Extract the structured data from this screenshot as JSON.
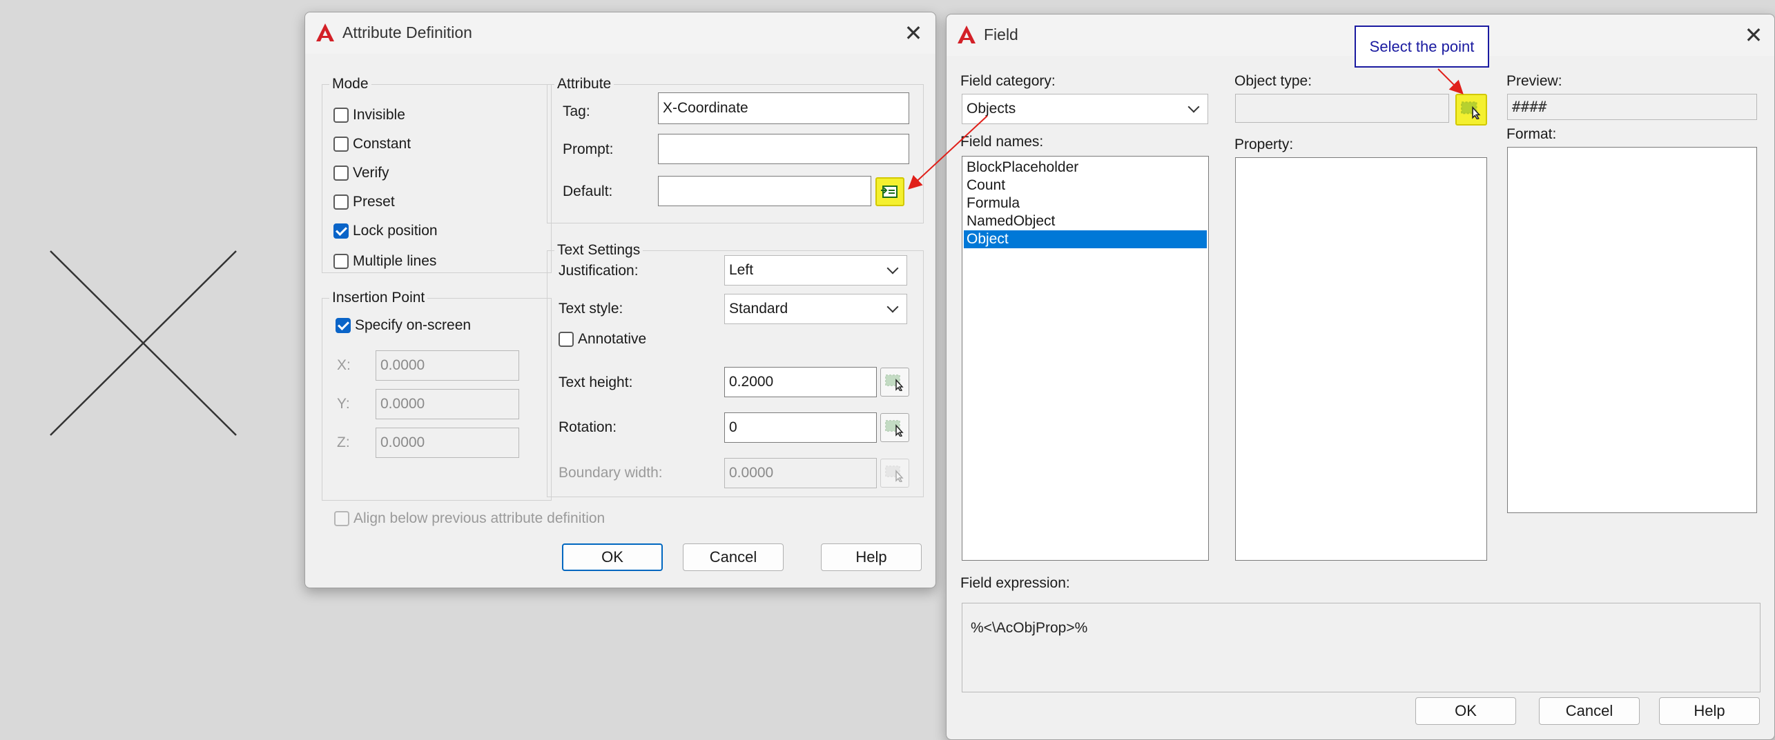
{
  "attr_dialog": {
    "title": "Attribute Definition",
    "mode": {
      "legend": "Mode",
      "items": [
        {
          "label": "Invisible",
          "checked": false
        },
        {
          "label": "Constant",
          "checked": false
        },
        {
          "label": "Verify",
          "checked": false
        },
        {
          "label": "Preset",
          "checked": false
        },
        {
          "label": "Lock position",
          "checked": true
        },
        {
          "label": "Multiple lines",
          "checked": false
        }
      ]
    },
    "insertion": {
      "legend": "Insertion Point",
      "specify_label": "Specify on-screen",
      "specify_checked": true,
      "x_label": "X:",
      "x_value": "0.0000",
      "y_label": "Y:",
      "y_value": "0.0000",
      "z_label": "Z:",
      "z_value": "0.0000"
    },
    "attribute": {
      "legend": "Attribute",
      "tag_label": "Tag:",
      "tag_value": "X-Coordinate",
      "prompt_label": "Prompt:",
      "prompt_value": "",
      "default_label": "Default:",
      "default_value": ""
    },
    "text_settings": {
      "legend": "Text Settings",
      "justification_label": "Justification:",
      "justification_value": "Left",
      "style_label": "Text style:",
      "style_value": "Standard",
      "annotative_label": "Annotative",
      "annotative_checked": false,
      "height_label": "Text height:",
      "height_value": "0.2000",
      "rotation_label": "Rotation:",
      "rotation_value": "0",
      "boundary_label": "Boundary width:",
      "boundary_value": "0.0000"
    },
    "align_label": "Align below previous attribute definition",
    "buttons": {
      "ok": "OK",
      "cancel": "Cancel",
      "help": "Help"
    }
  },
  "field_dialog": {
    "title": "Field",
    "category_label": "Field category:",
    "category_value": "Objects",
    "names_label": "Field names:",
    "names": [
      "BlockPlaceholder",
      "Count",
      "Formula",
      "NamedObject",
      "Object"
    ],
    "selected_name_index": 4,
    "object_type_label": "Object type:",
    "object_type_value": "",
    "property_label": "Property:",
    "preview_label": "Preview:",
    "preview_value": "####",
    "format_label": "Format:",
    "expression_label": "Field expression:",
    "expression_value": "%<\\AcObjProp>%",
    "buttons": {
      "ok": "OK",
      "cancel": "Cancel",
      "help": "Help"
    }
  },
  "callout": {
    "text": "Select the point"
  },
  "colors": {
    "highlight": "#f4f030",
    "selection": "#0078d7",
    "arrow": "#e0201a",
    "callout": "#1a1aa0"
  }
}
